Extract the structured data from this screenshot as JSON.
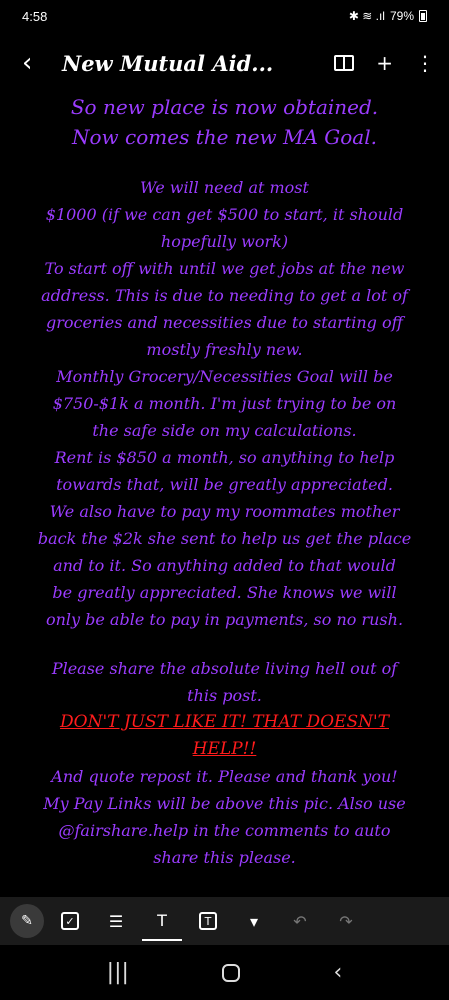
{
  "status": {
    "time": "4:58",
    "icons": "✱ ≋ .ıl",
    "battery": "79%"
  },
  "app_bar": {
    "title": "New Mutual Aid..."
  },
  "note": {
    "head": [
      "So new place is now obtained.",
      "Now comes the new MA Goal."
    ],
    "body1": [
      "We will need at most",
      "$1000 (if we can get $500 to start, it should",
      "hopefully work)",
      "To start off with until we get jobs at the new",
      "address. This is due to needing to get a lot of",
      "groceries and necessities due to starting off",
      "mostly freshly new.",
      "Monthly Grocery/Necessities Goal will be",
      "$750-$1k a month. I'm just trying to be on",
      "the safe side on my calculations.",
      "Rent is $850 a month, so anything to help",
      "towards that, will be greatly appreciated.",
      "We also have to pay my roommates mother",
      "back the $2k she sent to help us get the place",
      "and to it. So anything added to that would",
      "be greatly appreciated. She knows we will",
      "only be able to pay in payments, so no rush."
    ],
    "body2": [
      "Please share the absolute living hell out of",
      "this post."
    ],
    "warning": [
      "DON'T JUST LIKE IT! THAT DOESN'T",
      "HELP!!"
    ],
    "body3": [
      "And quote repost it. Please and thank you!",
      "My Pay Links will be above this pic. Also use",
      "@fairshare.help in the comments to auto",
      "share this please."
    ]
  },
  "toolbar": {
    "check": "✓",
    "text_style": "T",
    "text_box": "T"
  },
  "colors": {
    "text": "#9b3cff",
    "warning": "#ff1c1c",
    "background": "#000000"
  }
}
